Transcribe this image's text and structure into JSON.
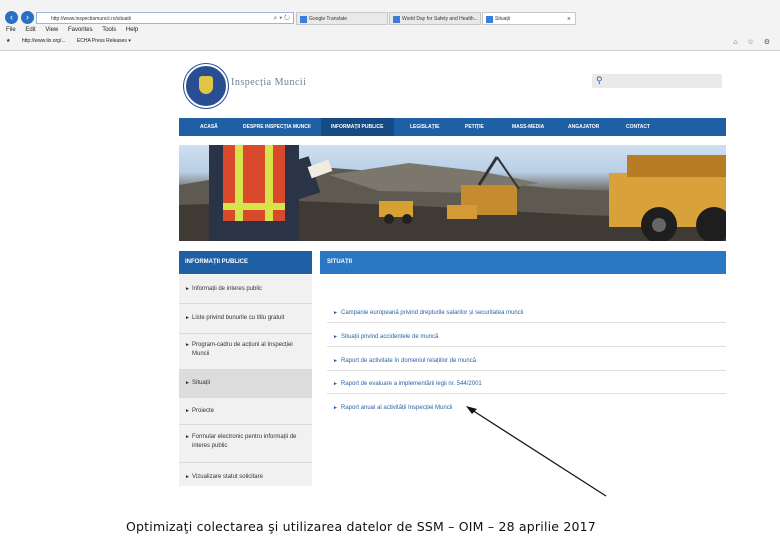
{
  "browser": {
    "address_url": "http://www.inspectiamuncii.ro/situatii",
    "tabs": [
      {
        "label": "Google Translate"
      },
      {
        "label": "World Day for Safety and Health..."
      },
      {
        "label": "Situații",
        "active": true
      }
    ],
    "menu": [
      "File",
      "Edit",
      "View",
      "Favorites",
      "Tools",
      "Help"
    ],
    "favorites": [
      "http://www.ilo.org/...",
      "ECHA Press Releases ▾"
    ]
  },
  "site": {
    "title": "Inspecția Muncii",
    "nav": [
      "ACASĂ",
      "DESPRE INSPECȚIA MUNCII",
      "INFORMAȚII PUBLICE",
      "LEGISLAȚIE",
      "PETIȚIE",
      "MASS-MEDIA",
      "ANGAJATOR",
      "CONTACT"
    ],
    "nav_selected": "INFORMAȚII PUBLICE"
  },
  "sidebar": {
    "heading": "INFORMAȚII PUBLICE",
    "items": [
      {
        "label": "Informații de interes public"
      },
      {
        "label": "Liste privind bunurile cu titlu gratuit"
      },
      {
        "label": "Program-cadru de acțiuni al Inspecției Muncii"
      },
      {
        "label": "Situații",
        "selected": true
      },
      {
        "label": "Proiecte"
      },
      {
        "label": "Formular electronic pentru informații de interes public"
      },
      {
        "label": "Vizualizare statut solicitare"
      }
    ]
  },
  "main": {
    "heading": "SITUAȚII",
    "links": [
      {
        "label": "Campanie europeană privind drepturile salarilor și securitatea muncii"
      },
      {
        "label": "Situații privind accidentele de muncă"
      },
      {
        "label": "Raport de activitate în domeniul relațiilor de muncă"
      },
      {
        "label": "Raport de evaluare a implementării legii nr. 544/2001"
      },
      {
        "label": "Raport anual al activității Inspecției Muncii"
      }
    ]
  },
  "caption": "Optimizaţi colectarea şi utilizarea datelor de SSM – OIM – 28 aprilie 2017",
  "colors": {
    "nav_blue": "#1f5fa4",
    "heading_blue": "#2a77c4",
    "link_blue": "#2a63a8"
  }
}
